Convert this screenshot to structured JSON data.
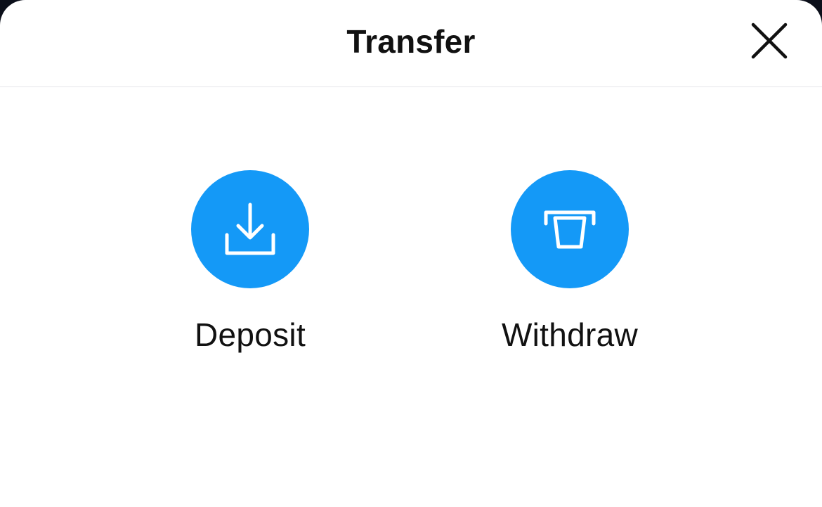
{
  "header": {
    "title": "Transfer",
    "close_icon": "close-icon"
  },
  "actions": [
    {
      "label": "Deposit",
      "icon": "download-tray-icon"
    },
    {
      "label": "Withdraw",
      "icon": "atm-card-slot-icon"
    }
  ],
  "colors": {
    "accent": "#1499f7",
    "text": "#111111",
    "background": "#ffffff",
    "divider": "#e6e6e9"
  }
}
